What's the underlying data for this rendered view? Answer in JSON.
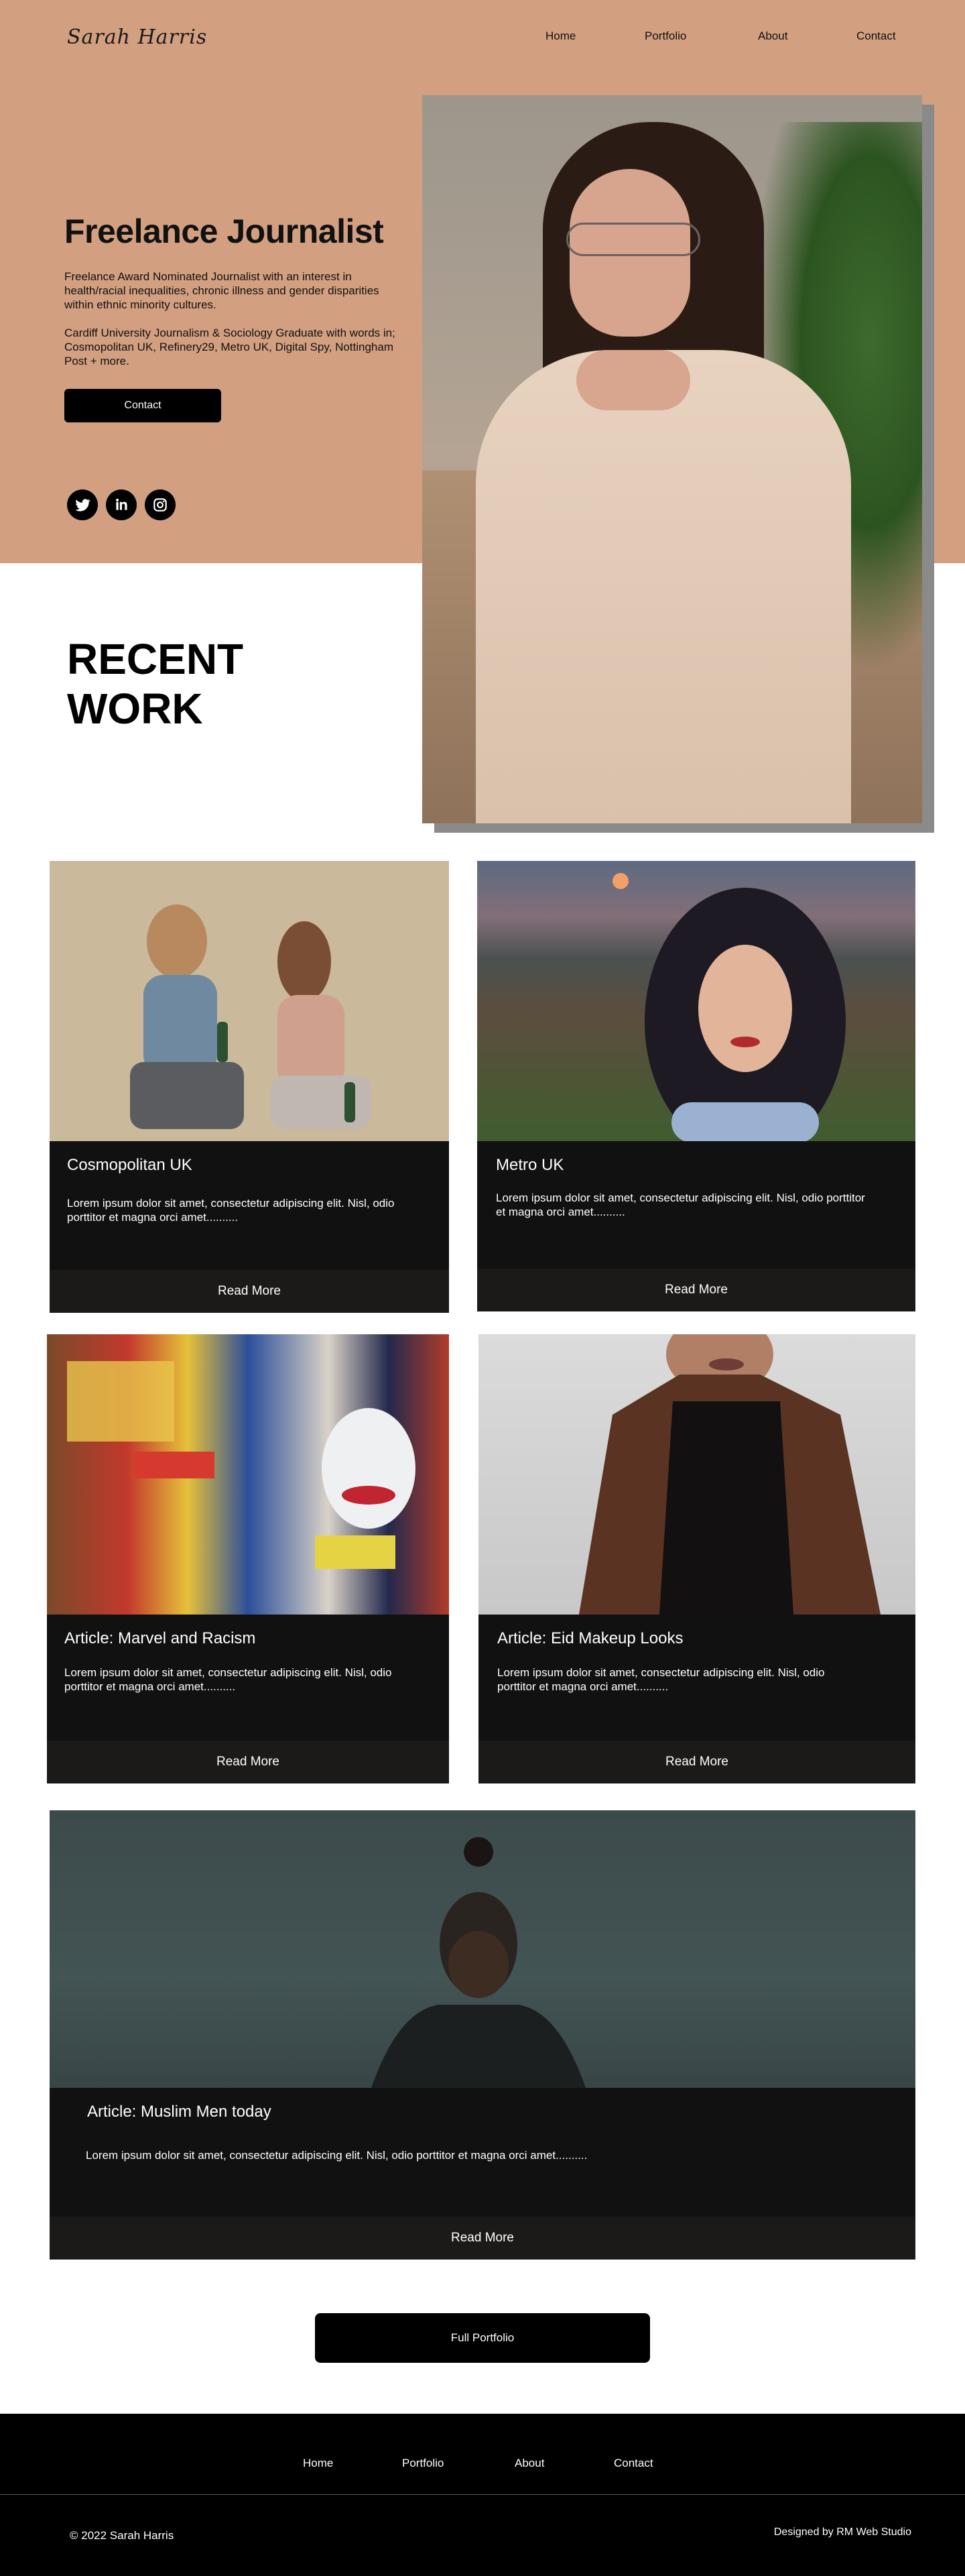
{
  "header": {
    "logo": "Sarah Harris",
    "nav": [
      "Home",
      "Portfolio",
      "About",
      "Contact"
    ]
  },
  "hero": {
    "title": "Freelance Journalist",
    "paragraph1": "Freelance Award Nominated Journalist with an interest in health/racial inequalities, chronic illness and gender disparities within ethnic minority cultures.",
    "paragraph2": "Cardiff University Journalism & Sociology Graduate with words in; Cosmopolitan UK, Refinery29, Metro UK, Digital Spy, Nottingham Post + more.",
    "contact_label": "Contact",
    "social_icons": [
      "twitter-icon",
      "linkedin-icon",
      "instagram-icon"
    ],
    "accent_color": "#d29f80"
  },
  "recent_work": {
    "heading_line1": "RECENT",
    "heading_line2": "WORK"
  },
  "cards": [
    {
      "title": "Cosmopolitan UK",
      "description": "Lorem ipsum dolor sit amet, consectetur adipiscing elit. Nisl, odio porttitor et magna orci amet..........",
      "button": "Read More"
    },
    {
      "title": "Metro UK",
      "description": "Lorem ipsum dolor sit amet, consectetur adipiscing elit. Nisl, odio porttitor et magna orci amet..........",
      "button": "Read More"
    },
    {
      "title": "Article: Marvel and Racism",
      "description": "Lorem ipsum dolor sit amet, consectetur adipiscing elit. Nisl, odio porttitor et magna orci amet..........",
      "button": "Read More"
    },
    {
      "title": "Article: Eid Makeup Looks",
      "description": "Lorem ipsum dolor sit amet, consectetur adipiscing elit. Nisl, odio porttitor et magna orci amet..........",
      "button": "Read More"
    },
    {
      "title": "Article: Muslim Men today",
      "description": "Lorem ipsum dolor sit amet, consectetur adipiscing elit. Nisl, odio porttitor et magna orci amet..........",
      "button": "Read More"
    }
  ],
  "full_portfolio_label": "Full Portfolio",
  "footer": {
    "nav": [
      "Home",
      "Portfolio",
      "About",
      "Contact"
    ],
    "copyright": "© 2022 Sarah Harris",
    "credit": "Designed by RM Web Studio"
  }
}
